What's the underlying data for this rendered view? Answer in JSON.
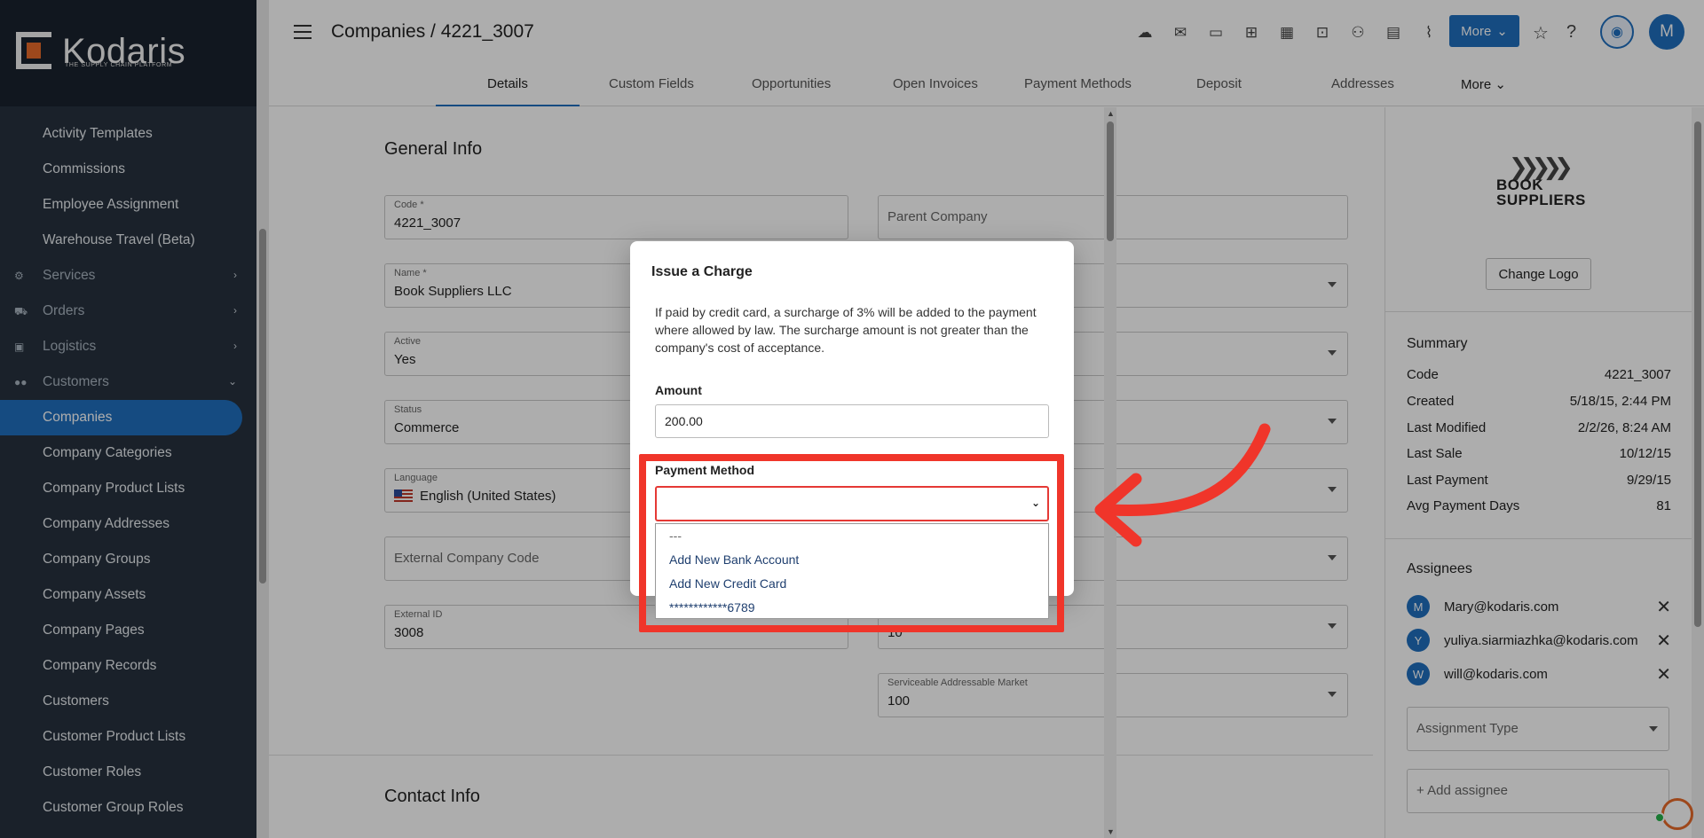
{
  "app": {
    "logo_text": "Kodaris",
    "logo_sub": "THE SUPPLY CHAIN PLATFORM"
  },
  "sidebar": {
    "items": [
      {
        "label": "Activity Templates",
        "type": "item"
      },
      {
        "label": "Commissions",
        "type": "item"
      },
      {
        "label": "Employee Assignment",
        "type": "item"
      },
      {
        "label": "Warehouse Travel (Beta)",
        "type": "item"
      },
      {
        "label": "Services",
        "type": "section",
        "icon": "gears-icon"
      },
      {
        "label": "Orders",
        "type": "section",
        "icon": "truck-icon"
      },
      {
        "label": "Logistics",
        "type": "section",
        "icon": "logistics-icon"
      },
      {
        "label": "Customers",
        "type": "section",
        "icon": "people-icon",
        "expanded": true
      },
      {
        "label": "Companies",
        "type": "item",
        "active": true
      },
      {
        "label": "Company Categories",
        "type": "item"
      },
      {
        "label": "Company Product Lists",
        "type": "item"
      },
      {
        "label": "Company Addresses",
        "type": "item"
      },
      {
        "label": "Company Groups",
        "type": "item"
      },
      {
        "label": "Company Assets",
        "type": "item"
      },
      {
        "label": "Company Pages",
        "type": "item"
      },
      {
        "label": "Company Records",
        "type": "item"
      },
      {
        "label": "Customers",
        "type": "item"
      },
      {
        "label": "Customer Product Lists",
        "type": "item"
      },
      {
        "label": "Customer Roles",
        "type": "item"
      },
      {
        "label": "Customer Group Roles",
        "type": "item"
      }
    ]
  },
  "header": {
    "breadcrumb": "Companies / 4221_3007",
    "more_label": "More",
    "avatar_initial": "M",
    "toolbar_icons": [
      "cloud-upload-icon",
      "mail-icon",
      "payment-icon",
      "gift-icon",
      "building-icon",
      "screen-plus-icon",
      "add-person-icon",
      "add-document-icon",
      "attachment-icon"
    ]
  },
  "tabs": [
    {
      "label": "Details",
      "active": true
    },
    {
      "label": "Custom Fields"
    },
    {
      "label": "Opportunities"
    },
    {
      "label": "Open Invoices"
    },
    {
      "label": "Payment Methods"
    },
    {
      "label": "Deposit"
    },
    {
      "label": "Addresses"
    },
    {
      "label": "More"
    }
  ],
  "general_info": {
    "title": "General Info",
    "code_label": "Code *",
    "code_value": "4221_3007",
    "parent_placeholder": "Parent Company",
    "name_label": "Name *",
    "name_value": "Book Suppliers LLC",
    "active_label": "Active",
    "active_value": "Yes",
    "status_label": "Status",
    "status_value": "Commerce",
    "language_label": "Language",
    "language_value": "English (United States)",
    "ext_code_placeholder": "External Company Code",
    "ext_id_label": "External ID",
    "ext_id_value": "3008",
    "right_value_10": "10",
    "sam_label": "Serviceable Addressable Market",
    "sam_value": "100"
  },
  "contact_info": {
    "title": "Contact Info"
  },
  "right_panel": {
    "brand_line1": "BOOK",
    "brand_line2": "SUPPLIERS",
    "change_logo": "Change Logo",
    "summary_title": "Summary",
    "summary": [
      {
        "label": "Code",
        "value": "4221_3007"
      },
      {
        "label": "Created",
        "value": "5/18/15, 2:44 PM"
      },
      {
        "label": "Last Modified",
        "value": "2/2/26, 8:24 AM"
      },
      {
        "label": "Last Sale",
        "value": "10/12/15"
      },
      {
        "label": "Last Payment",
        "value": "9/29/15"
      },
      {
        "label": "Avg Payment Days",
        "value": "81"
      }
    ],
    "assignees_title": "Assignees",
    "assignees": [
      {
        "initial": "M",
        "email": "Mary@kodaris.com"
      },
      {
        "initial": "Y",
        "email": "yuliya.siarmiazhka@kodaris.com"
      },
      {
        "initial": "W",
        "email": "will@kodaris.com"
      }
    ],
    "assignment_type_placeholder": "Assignment Type",
    "add_assignee": "+ Add assignee"
  },
  "modal": {
    "title": "Issue a Charge",
    "description": "If paid by credit card, a surcharge of 3% will be added to the payment where allowed by law. The surcharge amount is not greater than the company's cost of acceptance.",
    "amount_label": "Amount",
    "amount_value": "200.00",
    "payment_method_label": "Payment Method",
    "payment_method_value": "",
    "options": [
      "---",
      "Add New Bank Account",
      "Add New Credit Card",
      "************6789"
    ],
    "link_fragment": "e"
  },
  "colors": {
    "sidebar_bg": "#27323e",
    "accent": "#1f6fbf",
    "annotation_red": "#f0352a",
    "logo_orange": "#e86a2a"
  }
}
